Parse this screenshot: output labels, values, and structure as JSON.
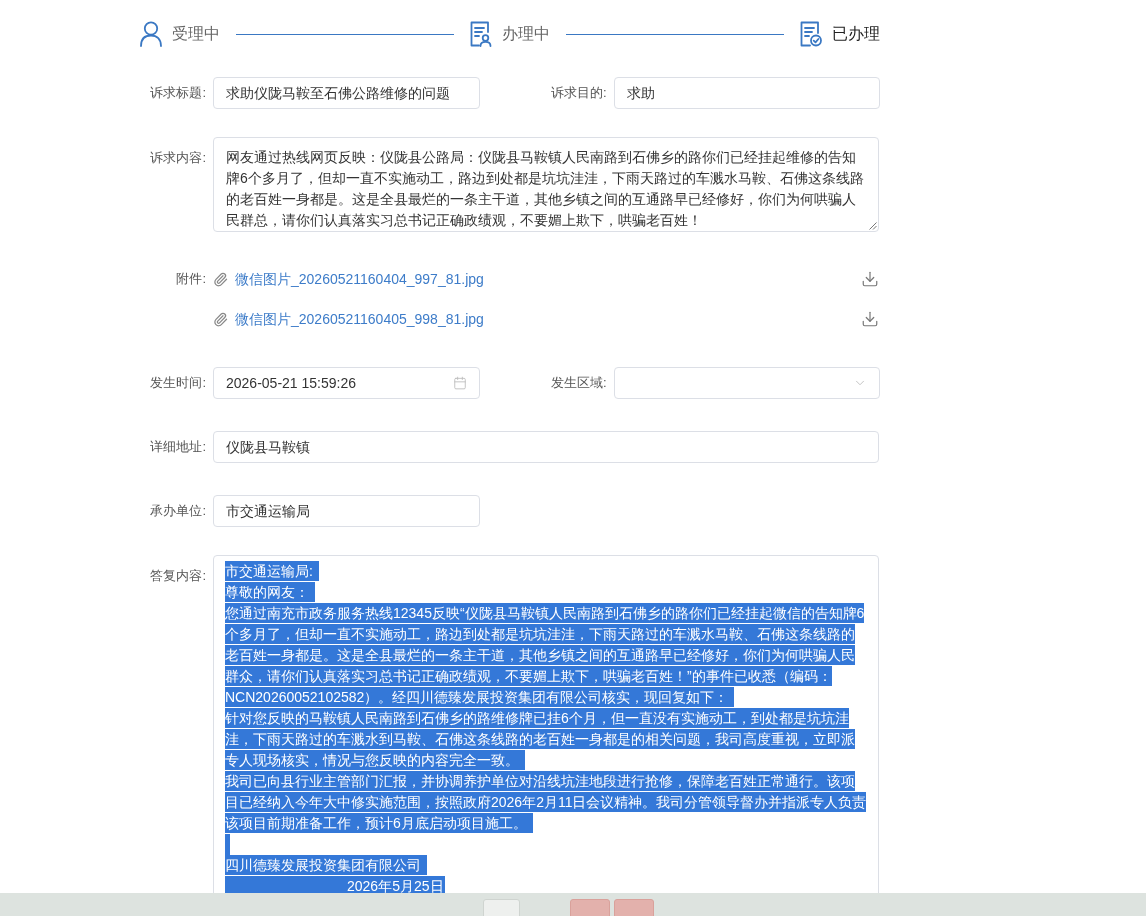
{
  "steps": [
    {
      "label": "受理中",
      "current": false
    },
    {
      "label": "办理中",
      "current": false
    },
    {
      "label": "已办理",
      "current": true
    }
  ],
  "form": {
    "title": {
      "label": "诉求标题:",
      "value": "求助仪陇马鞍至石佛公路维修的问题"
    },
    "purpose": {
      "label": "诉求目的:",
      "value": "求助"
    },
    "content": {
      "label": "诉求内容:",
      "value": "网友通过热线网页反映：仪陇县公路局：仪陇县马鞍镇人民南路到石佛乡的路你们已经挂起维修的告知牌6个多月了，但却一直不实施动工，路边到处都是坑坑洼洼，下雨天路过的车溅水马鞍、石佛这条线路的老百姓一身都是。这是全县最烂的一条主干道，其他乡镇之间的互通路早已经修好，你们为何哄骗人民群总，请你们认真落实习总书记正确政绩观，不要媚上欺下，哄骗老百姓！"
    },
    "attachments": {
      "label": "附件:",
      "files": [
        "微信图片_20260521160404_997_81.jpg",
        "微信图片_20260521160405_998_81.jpg"
      ]
    },
    "occurred_time": {
      "label": "发生时间:",
      "value": "2026-05-21 15:59:26"
    },
    "area": {
      "label": "发生区域:"
    },
    "address": {
      "label": "详细地址:",
      "value": "仪陇县马鞍镇"
    },
    "unit": {
      "label": "承办单位:",
      "value": "市交通运输局"
    },
    "reply": {
      "label": "答复内容:",
      "text_selected": true,
      "paragraphs": [
        {
          "kind": "text",
          "text": "市交通运输局:"
        },
        {
          "kind": "text",
          "text": "尊敬的网友："
        },
        {
          "kind": "text",
          "text": "您通过南充市政务服务热线12345反映“仪陇县马鞍镇人民南路到石佛乡的路你们已经挂起微信的告知牌6个多月了，但却一直不实施动工，路边到处都是坑坑洼洼，下雨天路过的车溅水马鞍、石佛这条线路的老百姓一身都是。这是全县最烂的一条主干道，其他乡镇之间的互通路早已经修好，你们为何哄骗人民群众，请你们认真落实习总书记正确政绩观，不要媚上欺下，哄骗老百姓！”的事件已收悉（编码：NCN20260052102582）。经四川德臻发展投资集团有限公司核实，现回复如下："
        },
        {
          "kind": "text",
          "text": "针对您反映的马鞍镇人民南路到石佛乡的路维修牌已挂6个月，但一直没有实施动工，到处都是坑坑洼洼，下雨天路过的车溅水到马鞍、石佛这条线路的老百姓一身都是的相关问题，我司高度重视，立即派专人现场核实，情况与您反映的内容完全一致。"
        },
        {
          "kind": "text",
          "text": "我司已向县行业主管部门汇报，并协调养护单位对沿线坑洼地段进行抢修，保障老百姓正常通行。该项目已经纳入今年大中修实施范围，按照政府2026年2月11日会议精神。我司分管领导督办并指派专人负责该项目前期准备工作，预计6月底启动项目施工。"
        },
        {
          "kind": "blank"
        },
        {
          "kind": "text",
          "text": "四川德臻发展投资集团有限公司"
        },
        {
          "kind": "indented",
          "text": "2026年5月25日"
        }
      ]
    }
  },
  "footer": {
    "buttons": [
      {
        "kind": "plain"
      },
      {
        "kind": "danger"
      },
      {
        "kind": "danger"
      }
    ]
  }
}
